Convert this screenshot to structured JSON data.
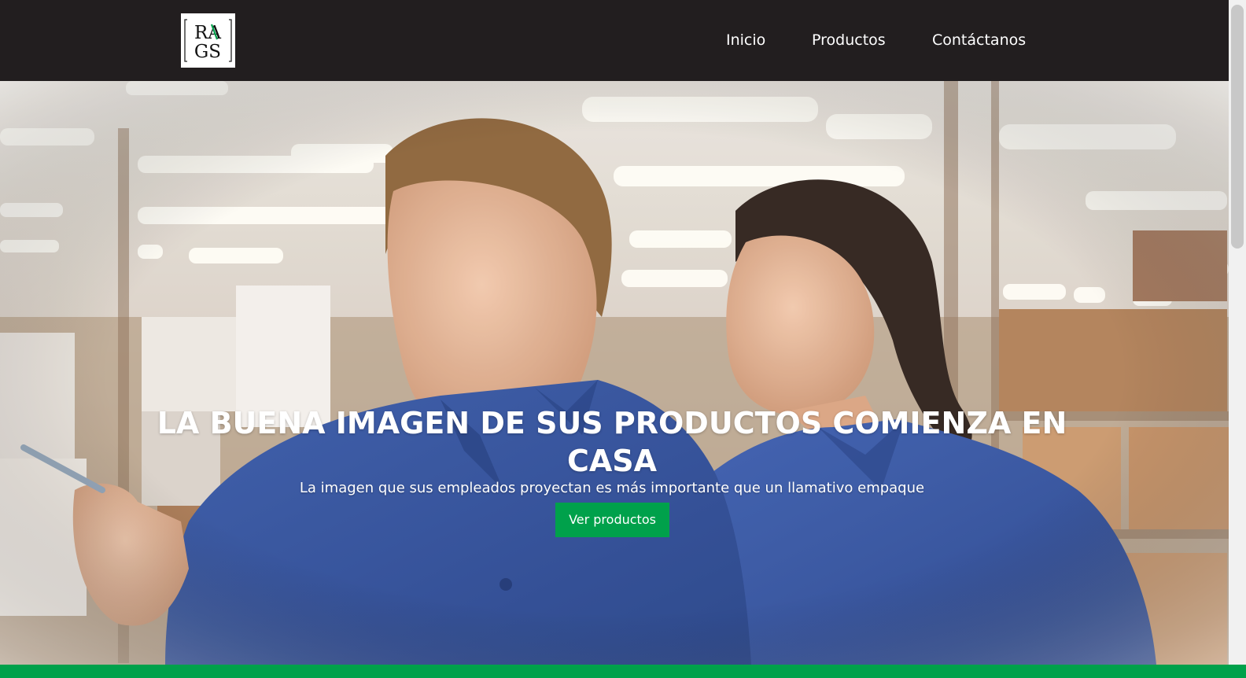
{
  "header": {
    "logo": {
      "line1": "RA",
      "line2": "GS"
    },
    "nav": [
      {
        "label": "Inicio"
      },
      {
        "label": "Productos"
      },
      {
        "label": "Contáctanos"
      }
    ]
  },
  "hero": {
    "title": "LA BUENA IMAGEN DE SUS PRODUCTOS COMIENZA EN CASA",
    "subtitle": "La imagen que sus empleados proyectan es más importante que un llamativo empaque",
    "cta_label": "Ver productos",
    "background": "photo of two employees in blue polo shirts in a warehouse"
  },
  "colors": {
    "navbar": "#221e1f",
    "accent": "#00a14b",
    "shirt": "#2d4fa0"
  }
}
